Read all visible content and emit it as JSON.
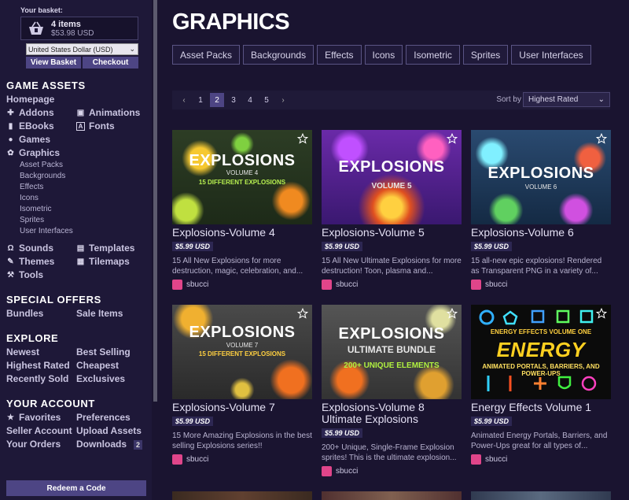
{
  "basket": {
    "label": "Your basket:",
    "count": "4 items",
    "total": "$53.98 USD",
    "currency": "United States Dollar (USD)",
    "view": "View Basket",
    "checkout": "Checkout"
  },
  "sidebar": {
    "game_assets": "GAME ASSETS",
    "homepage": "Homepage",
    "addons": "Addons",
    "animations": "Animations",
    "ebooks": "EBooks",
    "fonts": "Fonts",
    "games": "Games",
    "graphics": "Graphics",
    "sub": [
      "Asset Packs",
      "Backgrounds",
      "Effects",
      "Icons",
      "Isometric",
      "Sprites",
      "User Interfaces"
    ],
    "sounds": "Sounds",
    "templates": "Templates",
    "themes": "Themes",
    "tilemaps": "Tilemaps",
    "tools": "Tools",
    "special_offers": "SPECIAL OFFERS",
    "bundles": "Bundles",
    "sale_items": "Sale Items",
    "explore": "EXPLORE",
    "newest": "Newest",
    "best_selling": "Best Selling",
    "highest_rated": "Highest Rated",
    "cheapest": "Cheapest",
    "recently_sold": "Recently Sold",
    "exclusives": "Exclusives",
    "your_account": "YOUR ACCOUNT",
    "favorites": "Favorites",
    "preferences": "Preferences",
    "seller_account": "Seller Account",
    "upload_assets": "Upload Assets",
    "your_orders": "Your Orders",
    "downloads": "Downloads",
    "downloads_badge": "2",
    "redeem": "Redeem a Code"
  },
  "main": {
    "title": "GRAPHICS",
    "chips": [
      "Asset Packs",
      "Backgrounds",
      "Effects",
      "Icons",
      "Isometric",
      "Sprites",
      "User Interfaces"
    ],
    "pages": [
      "1",
      "2",
      "3",
      "4",
      "5"
    ],
    "current_page": "2",
    "prev": "‹",
    "next": "›",
    "sort_label": "Sort by",
    "sort_value": "Highest Rated"
  },
  "cards": [
    {
      "name": "Explosions-Volume 4",
      "price": "$5.99 USD",
      "desc": "15 All New Explosions for more destruction, magic, celebration, and...",
      "author": "sbucci",
      "thumb_title": "EXPLOSIONS",
      "thumb_vol": "VOLUME 4",
      "thumb_line": "15 DIFFERENT EXPLOSIONS",
      "bg": "#2a3a22"
    },
    {
      "name": "Explosions-Volume 5",
      "price": "$5.99 USD",
      "desc": "15 All New Ultimate Explosions for more destruction! Toon, plasma and...",
      "author": "sbucci",
      "thumb_title": "EXPLOSIONS",
      "thumb_vol": "VOLUME 5",
      "thumb_line": "",
      "bg": "#5a2a8a"
    },
    {
      "name": "Explosions-Volume 6",
      "price": "$5.99 USD",
      "desc": "15 all-new epic explosions! Rendered as Transparent PNG in a variety of...",
      "author": "sbucci",
      "thumb_title": "EXPLOSIONS",
      "thumb_vol": "VOLUME 6",
      "thumb_line": "",
      "bg": "#1e3a5a"
    },
    {
      "name": "Explosions-Volume 7",
      "price": "$5.99 USD",
      "desc": "15 More Amazing Explosions in the best selling Explosions series!!",
      "author": "sbucci",
      "thumb_title": "EXPLOSIONS",
      "thumb_vol": "VOLUME 7",
      "thumb_line": "15 DIFFERENT EXPLOSIONS",
      "bg": "#3a3a3a"
    },
    {
      "name": "Explosions-Volume 8 Ultimate Explosions",
      "price": "$5.99 USD",
      "desc": "200+ Unique, Single-Frame Explosion sprites! This is the ultimate explosion...",
      "author": "sbucci",
      "thumb_title": "EXPLOSIONS",
      "thumb_vol": "ULTIMATE BUNDLE",
      "thumb_line": "200+ UNIQUE ELEMENTS",
      "bg": "#4a4a4a"
    },
    {
      "name": "Energy Effects Volume 1",
      "price": "$5.99 USD",
      "desc": "Animated Energy Portals, Barriers, and Power-Ups great for all types of...",
      "author": "sbucci",
      "thumb_title": "ENERGY",
      "thumb_vol": "ENERGY EFFECTS VOLUME ONE",
      "thumb_line": "ANIMATED PORTALS, BARRIERS, AND POWER-UPS",
      "bg": "#0b0b0b"
    }
  ],
  "colors": {
    "accent": "#4d4584",
    "bg": "#1a1430",
    "sidebar": "#1e1838"
  }
}
